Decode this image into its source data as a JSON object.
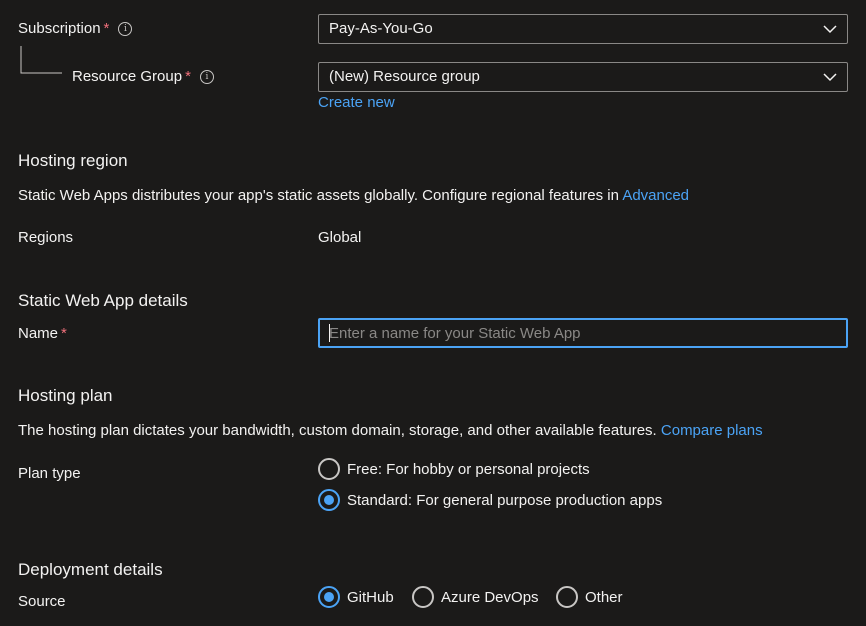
{
  "subscription": {
    "label": "Subscription",
    "required": "*",
    "info": "i",
    "value": "Pay-As-You-Go"
  },
  "resource_group": {
    "label": "Resource Group",
    "required": "*",
    "info": "i",
    "value": "(New) Resource group",
    "create_new": "Create new"
  },
  "hosting_region": {
    "title": "Hosting region",
    "description": "Static Web Apps distributes your app's static assets globally. Configure regional features in",
    "advanced_link": "Advanced",
    "regions_label": "Regions",
    "regions_value": "Global"
  },
  "details": {
    "title": "Static Web App details",
    "name_label": "Name",
    "required": "*",
    "name_value": "",
    "name_placeholder": "Enter a name for your Static Web App"
  },
  "hosting_plan": {
    "title": "Hosting plan",
    "description": "The hosting plan dictates your bandwidth, custom domain, storage, and other available features.",
    "compare_link": "Compare plans",
    "plan_type_label": "Plan type",
    "options": [
      {
        "label": "Free: For hobby or personal projects",
        "selected": false
      },
      {
        "label": "Standard: For general purpose production apps",
        "selected": true
      }
    ]
  },
  "deployment": {
    "title": "Deployment details",
    "source_label": "Source",
    "options": [
      {
        "label": "GitHub",
        "selected": true
      },
      {
        "label": "Azure DevOps",
        "selected": false
      },
      {
        "label": "Other",
        "selected": false
      }
    ]
  },
  "colors": {
    "background": "#1b1a19",
    "accent": "#4ba3f5",
    "required": "#f1707b"
  }
}
